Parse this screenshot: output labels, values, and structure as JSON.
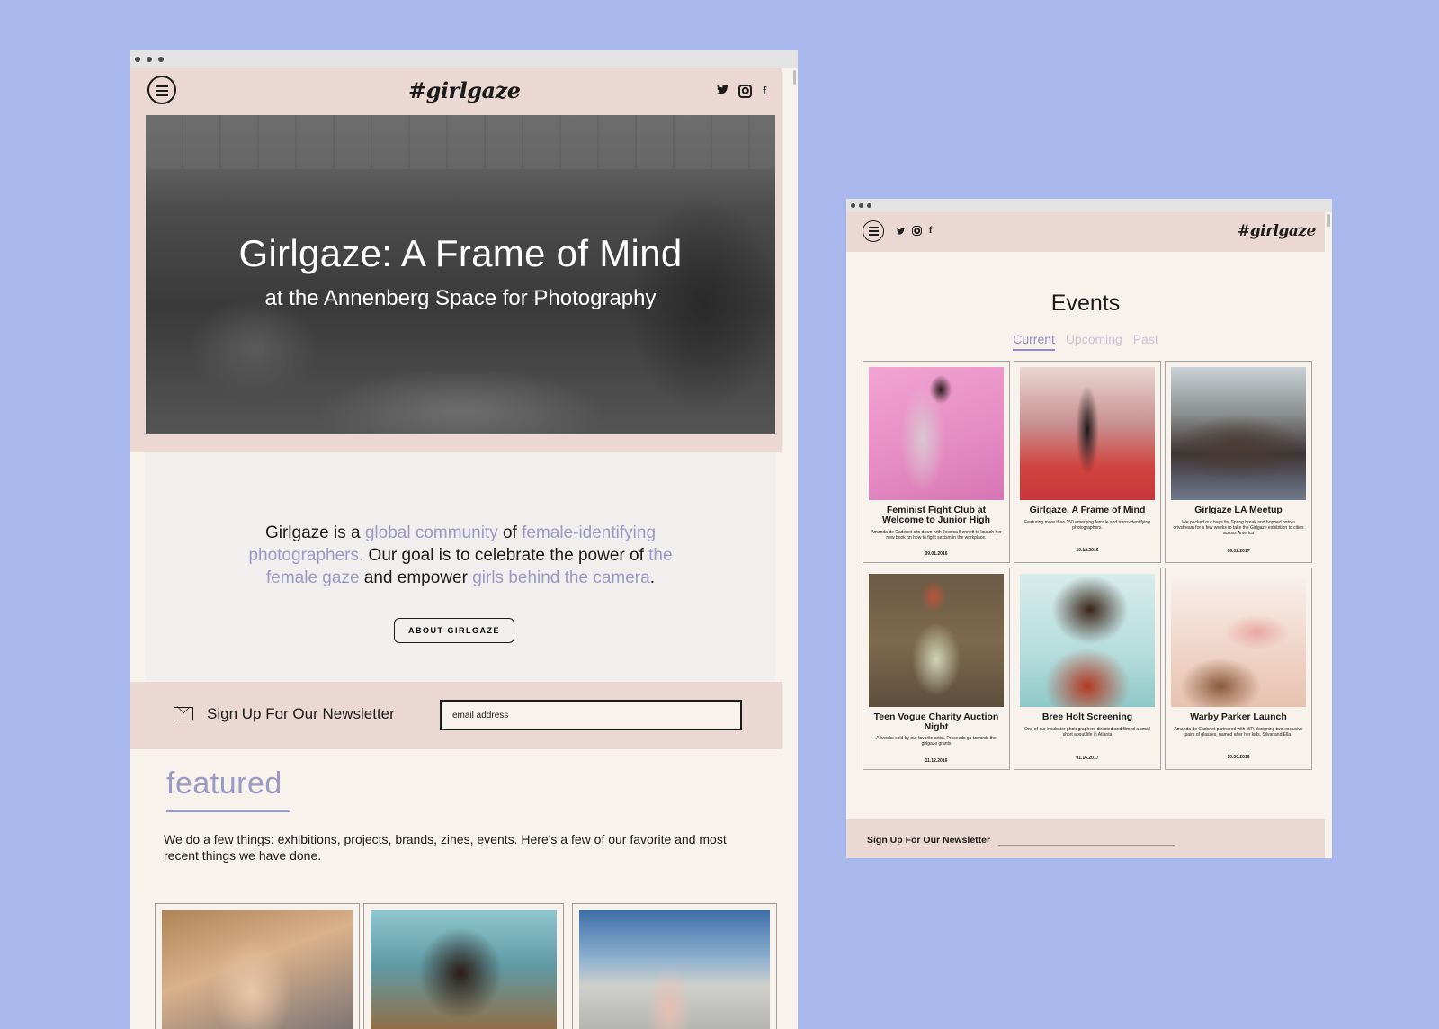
{
  "colors": {
    "background": "#a9b8ec",
    "header_pink": "#ecd8d2",
    "accent_lavender": "#9a9ac4",
    "page_cream": "#f7f2ec"
  },
  "main": {
    "logo": "#girlgaze",
    "social": {
      "twitter": "twitter-icon",
      "instagram": "instagram-icon",
      "facebook": "facebook-icon",
      "facebook_glyph": "f"
    },
    "hero": {
      "title": "Girlgaze: A Frame of Mind",
      "subtitle": "at the Annenberg Space for Photography"
    },
    "about": {
      "t1": "Girlgaze is a ",
      "h1": "global community",
      "t2": " of ",
      "h2": "female-identifying photographers.",
      "t3": " Our goal is to celebrate the power of ",
      "h3": "the female gaze",
      "t4": " and empower ",
      "h4": "girls behind the camera",
      "t5": ".",
      "button": "ABOUT GIRLGAZE"
    },
    "newsletter": {
      "label": "Sign Up For Our Newsletter",
      "placeholder": "email address"
    },
    "featured": {
      "title": "featured",
      "description": "We do a few things: exhibitions, projects, brands, zines, events. Here's a few of our favorite and most recent things we have done."
    }
  },
  "events": {
    "logo": "#girlgaze",
    "title": "Events",
    "tabs": [
      "Current",
      "Upcoming",
      "Past"
    ],
    "cards": [
      {
        "title": "Feminist Fight Club at Welcome to Junior High",
        "desc": "Amanda de Cadenet sits down with Jessica Bennett to launch her new book on how to fight sexism in the workplace.",
        "date": "09.01.2016"
      },
      {
        "title": "Girlgaze. A Frame of Mind",
        "desc": "Featuring more than 150 emerging female and trans-identifying photographers.",
        "date": "10.12.2016"
      },
      {
        "title": "Girlgaze LA Meetup",
        "desc": "We packed our bags for Spring break and hopped onto a drivstream for a few weeks to take the Girlgaze exhibition to cities across America",
        "date": "06.02.2017"
      },
      {
        "title": "Teen Vogue Charity Auction Night",
        "desc": "Artworks sold by our favorite artist. Proceeds go towards the girlgaze grants",
        "date": "11.12.2016"
      },
      {
        "title": "Bree Holt Screening",
        "desc": "One of our incubator photographers directed and filmed a small short about life in Atlanta",
        "date": "01.16.2017"
      },
      {
        "title": "Warby Parker Launch",
        "desc": "Amanda de Cadenet partnered with WP, designing two exclusive pairs of glasses, named after her kids, Silvanand Ella.",
        "date": "10.30.2016"
      }
    ],
    "newsletter": {
      "label": "Sign Up For Our Newsletter"
    }
  }
}
